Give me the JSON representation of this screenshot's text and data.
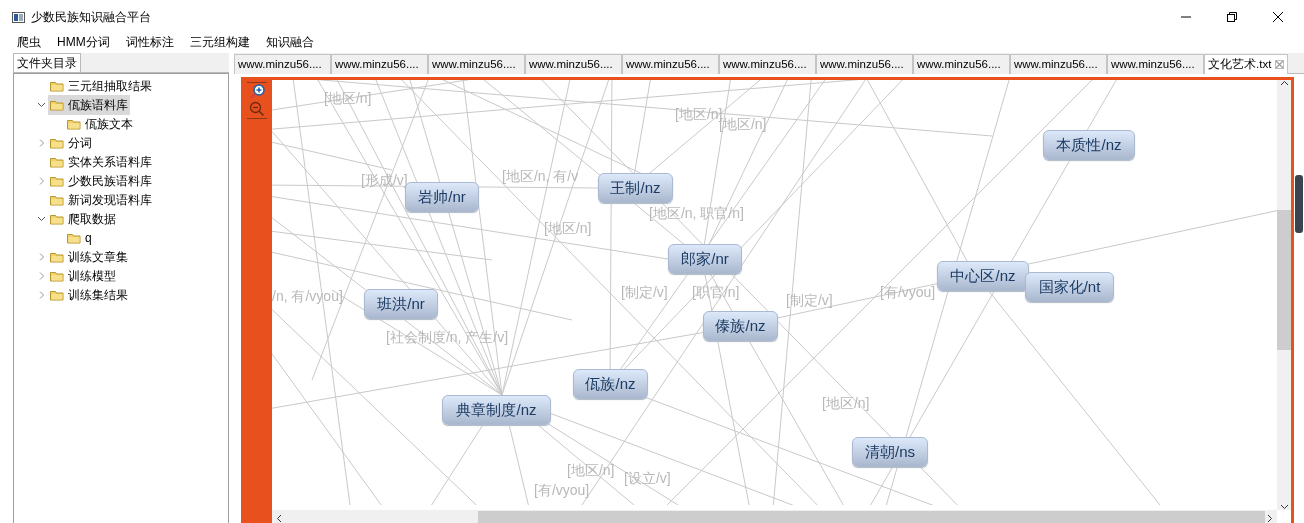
{
  "window": {
    "title": "少数民族知识融合平台"
  },
  "menu": [
    "爬虫",
    "HMM分词",
    "词性标注",
    "三元组构建",
    "知识融合"
  ],
  "sidebar": {
    "tab": "文件夹目录",
    "tree": [
      {
        "label": "三元组抽取结果",
        "selected": false
      },
      {
        "label": "佤族语料库",
        "selected": true,
        "expanded": true,
        "children": [
          {
            "label": "佤族文本",
            "selected": false
          }
        ]
      },
      {
        "label": "分词",
        "selected": false,
        "expanded": false
      },
      {
        "label": "实体关系语料库",
        "selected": false
      },
      {
        "label": "少数民族语料库",
        "selected": false,
        "expanded": false
      },
      {
        "label": "新词发现语料库",
        "selected": false
      },
      {
        "label": "爬取数据",
        "selected": false,
        "expanded": true,
        "children": [
          {
            "label": "q",
            "selected": false
          }
        ]
      },
      {
        "label": "训练文章集",
        "selected": false,
        "expanded": false
      },
      {
        "label": "训练模型",
        "selected": false,
        "expanded": false
      },
      {
        "label": "训练集结果",
        "selected": false,
        "expanded": false
      }
    ]
  },
  "tabs": [
    {
      "label": "www.minzu56....",
      "selected": false
    },
    {
      "label": "www.minzu56....",
      "selected": false
    },
    {
      "label": "www.minzu56....",
      "selected": false
    },
    {
      "label": "www.minzu56....",
      "selected": false
    },
    {
      "label": "www.minzu56....",
      "selected": false
    },
    {
      "label": "www.minzu56....",
      "selected": false
    },
    {
      "label": "www.minzu56....",
      "selected": false
    },
    {
      "label": "www.minzu56....",
      "selected": false
    },
    {
      "label": "www.minzu56....",
      "selected": false
    },
    {
      "label": "www.minzu56....",
      "selected": false
    },
    {
      "label": "文化艺术.txt",
      "selected": true
    }
  ],
  "graph": {
    "nodes": [
      {
        "label": "岩帅/nr"
      },
      {
        "label": "王制/nz"
      },
      {
        "label": "郎家/nr"
      },
      {
        "label": "班洪/nr"
      },
      {
        "label": "傣族/nz"
      },
      {
        "label": "佤族/nz"
      },
      {
        "label": "典章制度/nz"
      },
      {
        "label": "本质性/nz"
      },
      {
        "label": "中心区/nz"
      },
      {
        "label": "国家化/nt"
      },
      {
        "label": "清朝/ns"
      }
    ],
    "edge_labels": [
      "[地区/n]",
      "[地区/n]",
      "[地区/n]",
      "[地区/n, 有/v",
      "[形成/v]",
      "[地区/n, 职官/n]",
      "[地区/n]",
      "[制定/v]",
      "[职官/n]",
      "[制定/v]",
      "[有/vyou]",
      "[社会制度/n, 产生/v]",
      "/n, 有/vyou]",
      "[地区/n]",
      "[设立/v]",
      "[有/vyou]",
      "[地区/n]"
    ]
  }
}
